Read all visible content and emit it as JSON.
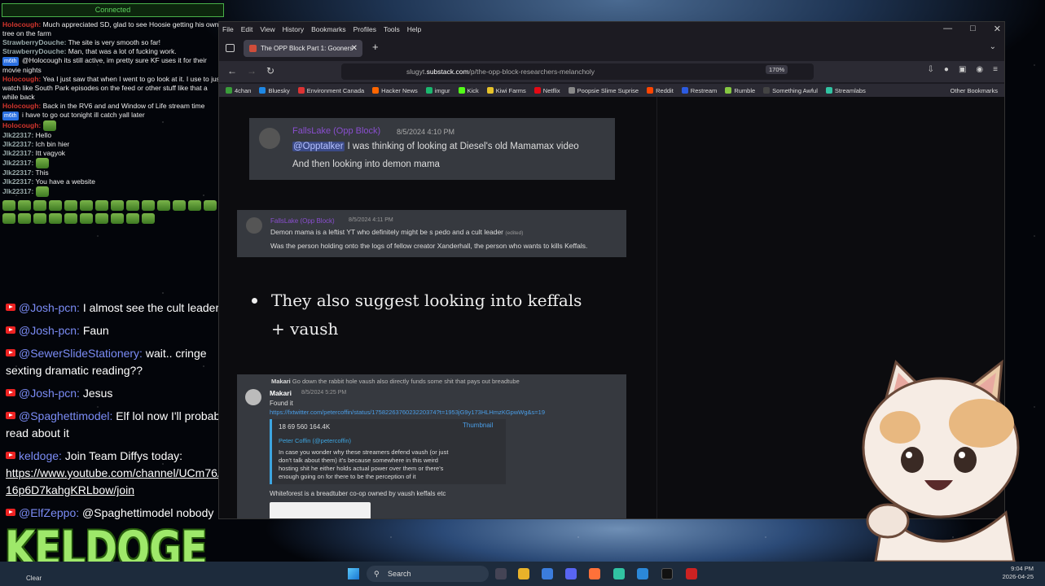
{
  "status": "Connected",
  "twitch": [
    {
      "user": "Holocough:",
      "cls": "red",
      "text": "Much appreciated SD, glad to see Hoosie getting his own tree on the farm"
    },
    {
      "user": "StrawberryDouche:",
      "cls": "gray",
      "text": "The site is very smooth so far!"
    },
    {
      "user": "StrawberryDouche:",
      "cls": "gray",
      "text": "Man, that was a lot of fucking work."
    },
    {
      "badge": "m6th",
      "user": "",
      "cls": "gray",
      "text": "@Holocough its still active, im pretty sure KF uses it for their movie nights"
    },
    {
      "user": "Holocough:",
      "cls": "red",
      "text": "Yea I just saw that when I went to go look at it.  I use to just watch like South Park episodes on the feed or other stuff like that a while back"
    },
    {
      "user": "Holocough:",
      "cls": "red",
      "text": "Back in the RV6 and and Window of Life stream time"
    },
    {
      "badge": "m6th",
      "user": "",
      "cls": "gray",
      "text": "i have to go out tonight ill catch yall later"
    },
    {
      "user": "Holocough:",
      "cls": "red",
      "text": ""
    },
    {
      "user": "Jlk22317:",
      "cls": "gray",
      "text": "Hello"
    },
    {
      "user": "Jlk22317:",
      "cls": "gray",
      "text": "Ich bin hier"
    },
    {
      "user": "Jlk22317:",
      "cls": "gray",
      "text": "Itt vagyok"
    },
    {
      "user": "Jlk22317:",
      "cls": "gray",
      "text": ""
    },
    {
      "user": "Jlk22317:",
      "cls": "gray",
      "text": "This"
    },
    {
      "user": "Jlk22317:",
      "cls": "gray",
      "text": "You have a website"
    },
    {
      "user": "Jlk22317:",
      "cls": "gray",
      "text": ""
    }
  ],
  "youtube": [
    {
      "user": "@Josh-pcn:",
      "text": "I almost see the cult leader"
    },
    {
      "user": "@Josh-pcn:",
      "text": "Faun"
    },
    {
      "user": "@SewerSlideStationery:",
      "text": "wait.. cringe sexting dramatic reading??"
    },
    {
      "user": "@Josh-pcn:",
      "text": "Jesus"
    },
    {
      "user": "@Spaghettimodel:",
      "text": "Elf lol now I'll probably read about it"
    },
    {
      "user": "keldoge:",
      "text": "Join Team Diffys today:",
      "link": "https://www.youtube.com/channel/UCm76Ac716p6D7kahgKRLbow/join"
    },
    {
      "user": "@ElfZeppo:",
      "text": "@Spaghettimodel nobody"
    }
  ],
  "logo": "KELDOGE",
  "browser": {
    "menu": [
      "File",
      "Edit",
      "View",
      "History",
      "Bookmarks",
      "Profiles",
      "Tools",
      "Help"
    ],
    "tab_title": "The OPP Block Part 1: Gooners",
    "url_prefix": "slugyt.",
    "url_domain": "substack.com",
    "url_path": "/p/the-opp-block-researchers-melancholy",
    "zoom": "170%",
    "bookmarks": [
      {
        "label": "4chan",
        "color": "#3a9d3a"
      },
      {
        "label": "Bluesky",
        "color": "#1e88e5"
      },
      {
        "label": "Environment Canada",
        "color": "#d33"
      },
      {
        "label": "Hacker News",
        "color": "#f60"
      },
      {
        "label": "imgur",
        "color": "#1bb76e"
      },
      {
        "label": "Kick",
        "color": "#53fc18"
      },
      {
        "label": "Kiwi Farms",
        "color": "#e6c229"
      },
      {
        "label": "Netflix",
        "color": "#e50914"
      },
      {
        "label": "Poopsie Slime Suprise",
        "color": "#888"
      },
      {
        "label": "Reddit",
        "color": "#ff4500"
      },
      {
        "label": "Restream",
        "color": "#2c5be0"
      },
      {
        "label": "Rumble",
        "color": "#85c742"
      },
      {
        "label": "Something Awful",
        "color": "#444"
      },
      {
        "label": "Streamlabs",
        "color": "#31c3a2"
      }
    ],
    "other_bookmarks": "Other Bookmarks"
  },
  "post": {
    "msg1": {
      "name": "FallsLake (Opp Block)",
      "time": "8/5/2024 4:10 PM",
      "mention": "@Opptalker",
      "line1": "I was thinking of looking at Diesel's old Mamamax video",
      "line2": "And then looking into demon mama"
    },
    "msg2": {
      "name": "FallsLake (Opp Block)",
      "time": "8/5/2024 4:11 PM",
      "line1": "Demon mama is a leftist YT who definitely might be s pedo and a cult leader",
      "edited": "(edited)",
      "line2": "Was the person holding onto the logs of fellow creator Xanderhall, the person who wants to kills Keffals."
    },
    "bullet": "They also suggest looking into keffals + vaush",
    "msg3": {
      "reply_user": "Makari",
      "reply_text": "Go down the rabbit hole vaush also directly funds some shit that pays out breadtube",
      "name": "Makari",
      "time": "8/5/2024 5:25 PM",
      "found": "Found it",
      "link": "https://fxtwitter.com/petercoffin/status/1758226376023220374?t=1953jG9y173HLHmzKGpwWg&s=19",
      "stats": "18   69   560   164.4K",
      "author": "Peter Coffin (@petercoffin)",
      "tweet": "In case you wonder why these streamers defend vaush (or just don't talk about them) it's because somewhere in this weird hosting shit he either holds actual power over them or there's enough going on for there to be the perception of it",
      "thumb": "Thumbnail",
      "whiteforest": "Whiteforest is a breadtuber co-op owned by vaush keffals etc"
    }
  },
  "taskbar": {
    "weather": "Clear",
    "search": "Search",
    "time": "9:04 PM",
    "date": "2026-04-25"
  }
}
